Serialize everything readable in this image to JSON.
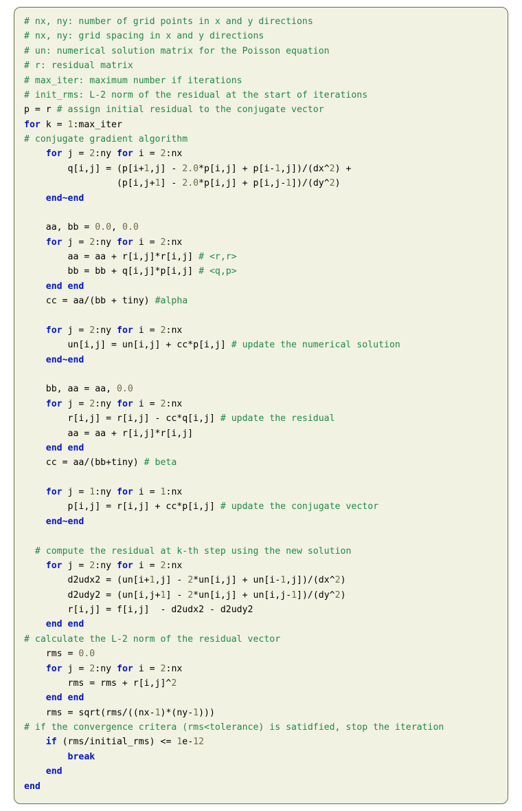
{
  "comments": {
    "c1": "# nx, ny: number of grid points in x and y directions",
    "c2": "# nx, ny: grid spacing in x and y directions",
    "c3": "# un: numerical solution matrix for the Poisson equation",
    "c4": "# r: residual matrix",
    "c5": "# max_iter: maximum number if iterations",
    "c6": "# init_rms: L-2 norm of the residual at the start of iterations",
    "c7": "# assign initial residual to the conjugate vector",
    "c8": "# conjugate gradient algorithm",
    "c9": "# <r,r>",
    "c10": "# <q,p>",
    "c11": "#alpha",
    "c12": "# update the numerical solution",
    "c13": "# update the residual",
    "c14": "# beta",
    "c15": "# update the conjugate vector",
    "c16": "# compute the residual at k-th step using the new solution",
    "c17": "# calculate the L-2 norm of the residual vector",
    "c18": "# if the convergence critera (rms<tolerance) is satidfied, stop the iteration"
  },
  "code": {
    "assign_p": "p = r ",
    "for_k": " k = ",
    "range_k": ":max_iter",
    "for_ji_2nx": " j = ",
    "range_j2ny": ":ny ",
    "range_i2nx": ":nx",
    "i_eq": " i = ",
    "q_line1": "        q[i,j] = (p[i+",
    "q_line1b": ",j] - ",
    "q_line1c": "*p[i,j] + p[i-",
    "q_line1d": ",j])/(dx^",
    "q_line1e": ") +",
    "q_line2a": "                 (p[i,j+",
    "q_line2b": "] - ",
    "q_line2c": "*p[i,j] + p[i,j-",
    "q_line2d": "])/(dy^",
    "q_line2e": ")",
    "end_tilde": "end~end",
    "end_end": "end end",
    "aabb_init": "    aa, bb = ",
    "aa_line": "        aa = aa + r[i,j]*r[i,j] ",
    "bb_line": "        bb = bb + q[i,j]*p[i,j] ",
    "cc_alpha": "    cc = aa/(bb + tiny) ",
    "un_line": "        un[i,j] = un[i,j] + cc*p[i,j] ",
    "bbaa_swap": "    bb, aa = aa, ",
    "r_update": "        r[i,j] = r[i,j] - cc*q[i,j] ",
    "aa_rr": "        aa = aa + r[i,j]*r[i,j]",
    "cc_beta": "    cc = aa/(bb+tiny) ",
    "p_update": "        p[i,j] = r[i,j] + cc*p[i,j] ",
    "range_j1ny": ":ny ",
    "range_i1nx": ":nx",
    "d2x_a": "        d2udx2 = (un[i+",
    "d2x_b": ",j] - ",
    "d2x_c": "*un[i,j] + un[i-",
    "d2x_d": ",j])/(dx^",
    "d2x_e": ")",
    "d2y_a": "        d2udy2 = (un[i,j+",
    "d2y_b": "] - ",
    "d2y_c": "*un[i,j] + un[i,j-",
    "d2y_d": "])/(dy^",
    "d2y_e": ")",
    "r_resid": "        r[i,j] = f[i,j]  - d2udx2 - d2udy2",
    "rms0": "    rms = ",
    "rms_accum": "        rms = rms + r[i,j]^",
    "rms_sqrt": "    rms = sqrt(rms/((nx-",
    "rms_sqrt_b": ")*(ny-",
    "rms_sqrt_c": ")))",
    "if_cond": " (rms/initial_rms) <= ",
    "tol": "e-"
  },
  "nums": {
    "one": "1",
    "two": "2",
    "twof": "2.0",
    "zero": "0.0",
    "twelve": "12"
  },
  "kw": {
    "for": "for",
    "end": "end",
    "if": "if",
    "break": "break"
  }
}
